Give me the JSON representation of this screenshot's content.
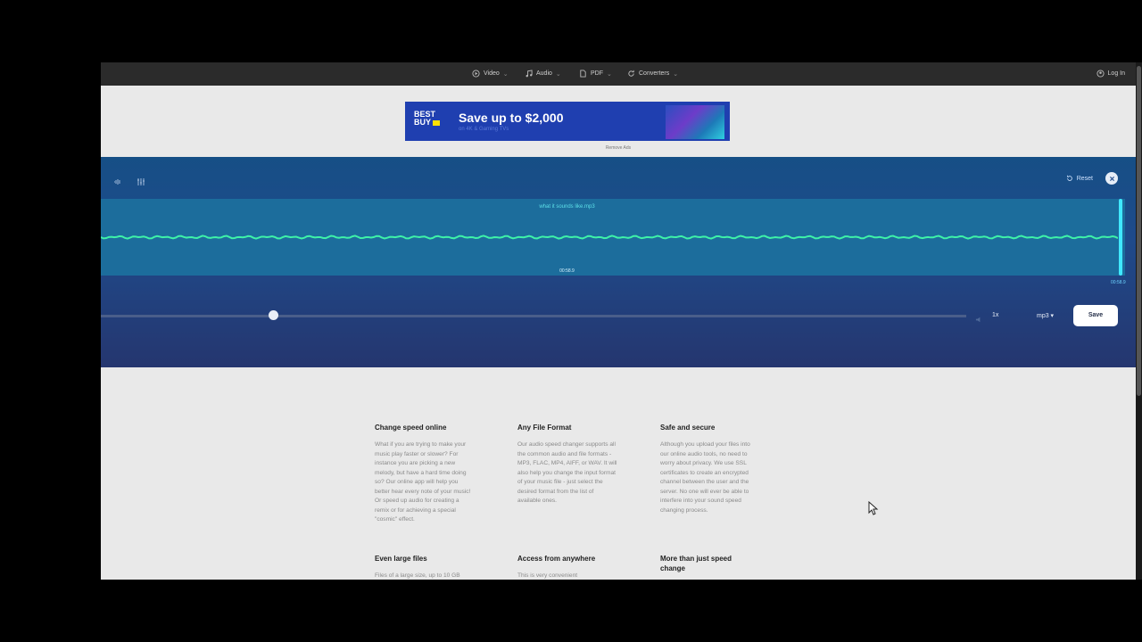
{
  "nav": {
    "items": [
      {
        "label": "Video",
        "icon": "play-icon"
      },
      {
        "label": "Audio",
        "icon": "music-note-icon"
      },
      {
        "label": "PDF",
        "icon": "document-icon"
      },
      {
        "label": "Converters",
        "icon": "refresh-icon"
      }
    ],
    "login": "Log In"
  },
  "ad": {
    "brand": "BEST BUY",
    "headline": "Save up to $2,000",
    "subline": "on 4K & Gaming TVs",
    "remove_ads": "Remove Ads"
  },
  "editor": {
    "reset_label": "Reset",
    "filename": "what it sounds like.mp3",
    "center_time": "00:58.9",
    "end_time": "00:58.9",
    "speed_label": "1x",
    "format_label": "mp3 ▾",
    "save_label": "Save",
    "speed_position_fraction": 0.2,
    "colors": {
      "wave": "#3ef2a8",
      "accent": "#40e8ff",
      "panel": "#1f4a8a"
    }
  },
  "features": [
    {
      "title": "Change speed online",
      "body": "What if you are trying to make your music play faster or slower? For instance you are picking a new melody, but have a hard time doing so? Our online app will help you better hear every note of your music! Or speed up audio for creating a remix or for achieving a special \"cosmic\" effect."
    },
    {
      "title": "Any File Format",
      "body": "Our audio speed changer supports all the common audio and file formats - MP3, FLAC, MP4, AIFF, or WAV. It will also help you change the input format of your music file - just select the desired format from the list of available ones."
    },
    {
      "title": "Safe and secure",
      "body": "Although you upload your files into our online audio tools, no need to worry about privacy. We use SSL certificates to create an encrypted channel between the user and the server. No one will ever be able to interfere into your sound speed changing process."
    },
    {
      "title": "Even large files",
      "body": "Files of a large size, up to 10 GB"
    },
    {
      "title": "Access from anywhere",
      "body": "This is very convenient"
    },
    {
      "title": "More than just speed change",
      "body": ""
    }
  ]
}
